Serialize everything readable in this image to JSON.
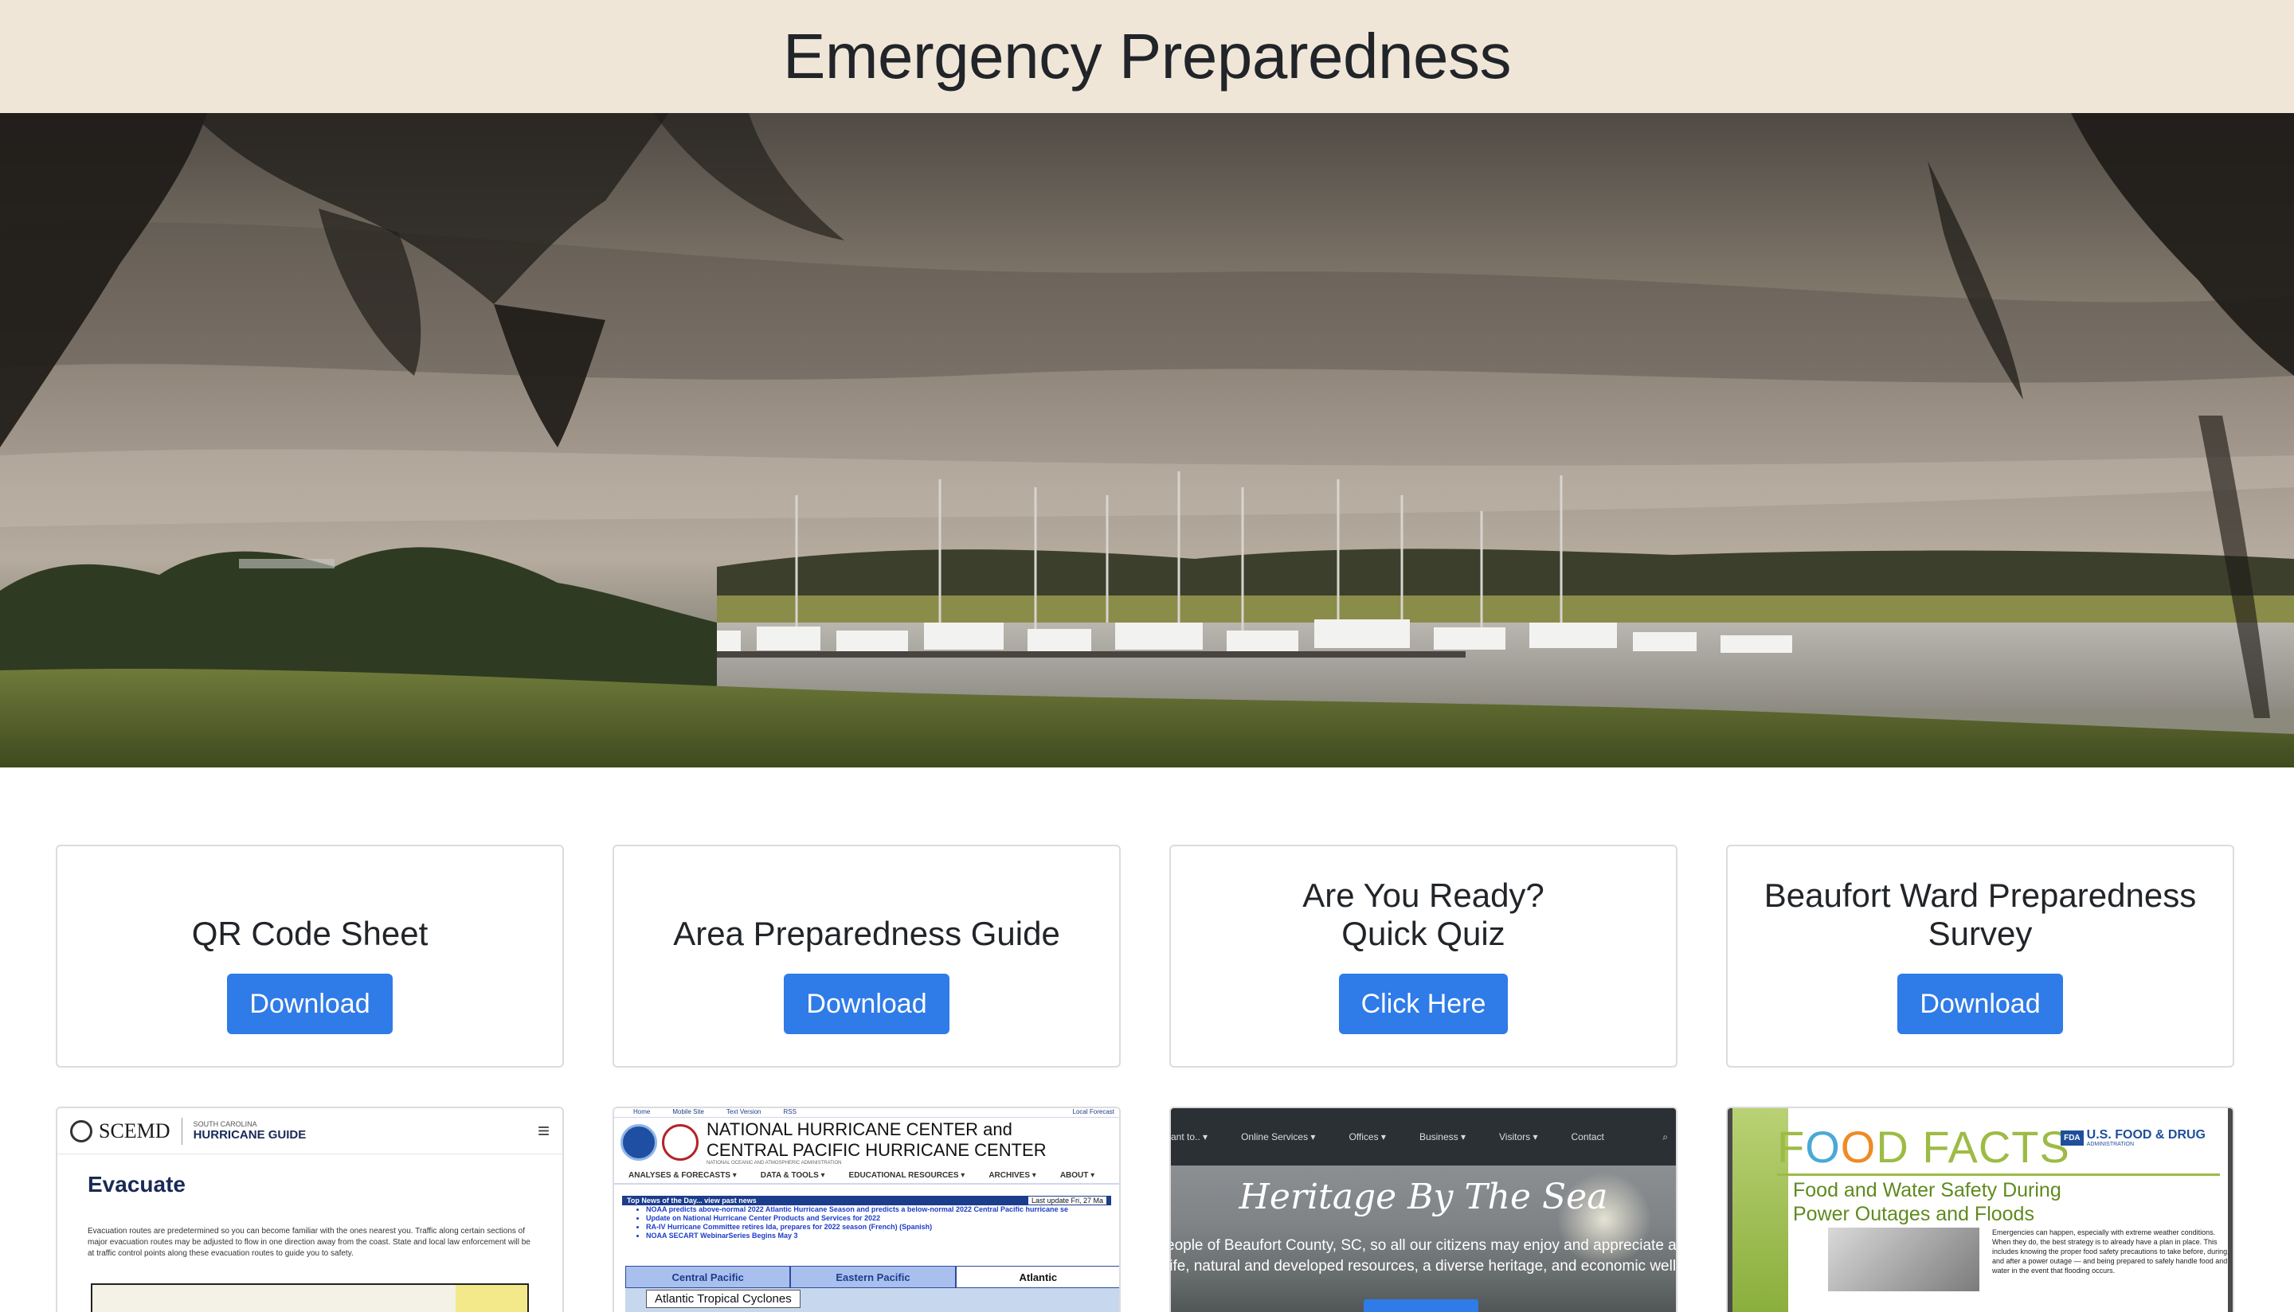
{
  "header": {
    "title": "Emergency Preparedness"
  },
  "cards": [
    {
      "title": "QR Code Sheet",
      "button": "Download"
    },
    {
      "title": "Area Preparedness Guide",
      "button": "Download"
    },
    {
      "title": "Are You Ready?\nQuick Quiz",
      "button": "Click Here"
    },
    {
      "title": "Beaufort Ward Preparedness\nSurvey",
      "button": "Download"
    }
  ],
  "thumbs": {
    "scemd": {
      "brand": "SCEMD",
      "sub_small": "SOUTH CAROLINA",
      "sub_bold": "HURRICANE GUIDE",
      "heading": "Evacuate",
      "body": "Evacuation routes are predetermined so you can become familiar with the ones nearest you. Traffic along certain sections of major evacuation routes may be adjusted to flow in one direction away from the coast. State and local law enforcement will be at traffic control points along these evacuation routes to guide you to safety."
    },
    "nhc": {
      "nav1": [
        "Home",
        "Mobile Site",
        "Text Version",
        "RSS",
        "Local Forecast"
      ],
      "title1": "NATIONAL HURRICANE CENTER and",
      "title2": "CENTRAL PACIFIC HURRICANE CENTER",
      "agency": "NATIONAL OCEANIC AND ATMOSPHERIC ADMINISTRATION",
      "nav2": [
        "ANALYSES & FORECASTS ▾",
        "DATA & TOOLS ▾",
        "EDUCATIONAL RESOURCES ▾",
        "ARCHIVES ▾",
        "ABOUT ▾"
      ],
      "news_bar": "Top News of the Day... view past news",
      "news_update": "Last update Fri, 27 Ma",
      "news": [
        "NOAA predicts above-normal 2022 Atlantic Hurricane Season and predicts a below-normal 2022 Central Pacific hurricane se",
        "Update on National Hurricane Center Products and Services for 2022",
        "RA-IV Hurricane Committee retires Ida, prepares for 2022 season (French) (Spanish)",
        "NOAA SECART WebinarSeries Begins May 3"
      ],
      "tabs": [
        "Central Pacific",
        "Eastern Pacific",
        "Atlantic"
      ],
      "map_label": "Atlantic Tropical Cyclones"
    },
    "beaufort": {
      "nav": [
        "ant to.. ▾",
        "Online Services ▾",
        "Offices ▾",
        "Business ▾",
        "Visitors ▾",
        "Contact",
        "⌕"
      ],
      "script": "Heritage By The Sea",
      "line1": "eople of Beaufort County, SC, so all our citizens may enjoy and appreciate a prote",
      "line2": "life, natural and developed resources, a diverse heritage, and economic well-bein"
    },
    "fda": {
      "brand": "FDA",
      "agency1": "U.S. FOOD & DRUG",
      "agency2": "ADMINISTRATION",
      "sub1": "Food and Water Safety During",
      "sub2": "Power Outages and Floods",
      "body": "Emergencies can happen, especially with extreme weather conditions. When they do, the best strategy is to already have a plan in place. This includes knowing the proper food safety precautions to take before, during, and after a power outage — and being prepared to safely handle food and water in the event that flooding occurs."
    }
  },
  "colors": {
    "header_bg": "#f0e6d8",
    "button": "#2f7be8"
  }
}
